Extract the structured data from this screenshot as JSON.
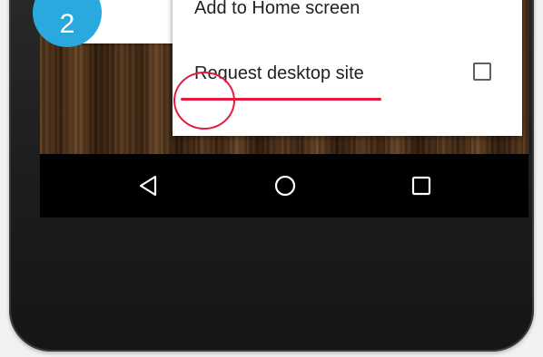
{
  "step_badge": {
    "number": "2",
    "color": "#2aa9df"
  },
  "menu": {
    "items": [
      {
        "label": "Add to Home screen",
        "icon": null
      },
      {
        "label": "Request desktop site",
        "control": "checkbox",
        "checked": false
      }
    ]
  },
  "annotation": {
    "color": "#e41b3c"
  },
  "navbar": {
    "buttons": [
      {
        "icon": "back-triangle-icon"
      },
      {
        "icon": "home-circle-icon"
      },
      {
        "icon": "recents-square-icon"
      }
    ]
  }
}
